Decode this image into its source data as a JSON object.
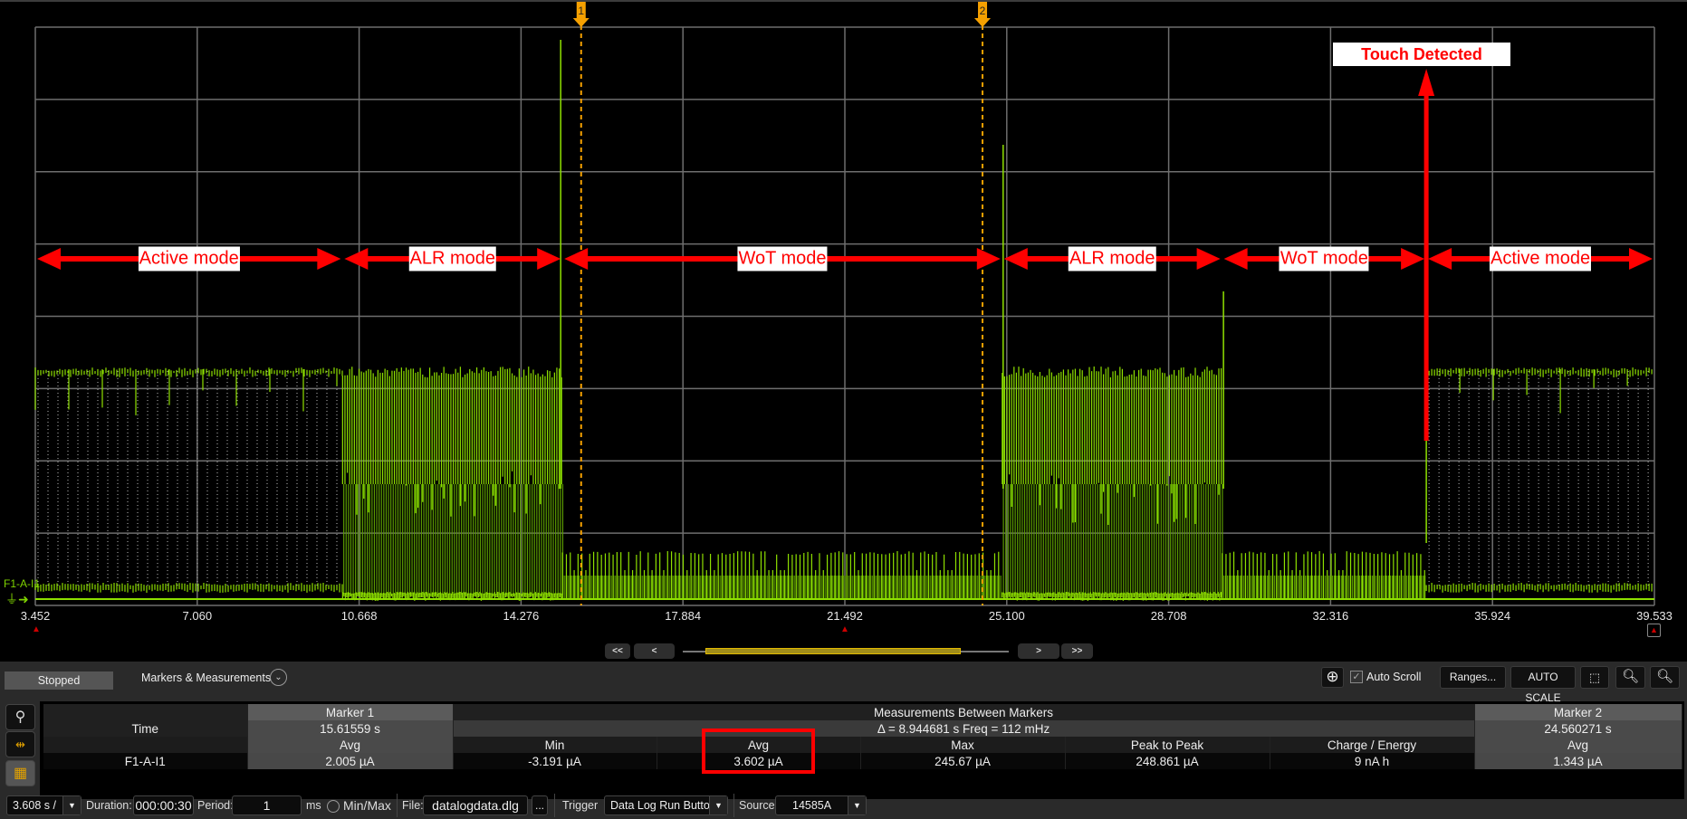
{
  "plot": {
    "channel_label": "F1-A-I1",
    "x_ticks": [
      "3.452",
      "7.060",
      "10.668",
      "14.276",
      "17.884",
      "21.492",
      "25.100",
      "28.708",
      "32.316",
      "35.924",
      "39.533"
    ],
    "x_range_s": [
      3.452,
      39.533
    ],
    "markers": [
      {
        "label": "1",
        "time_s": 15.61559
      },
      {
        "label": "2",
        "time_s": 24.560271
      }
    ],
    "trace_color": "#8ee000",
    "marker_color": "#f5a000",
    "annotation_color": "#ff0000",
    "annotations": {
      "modes": [
        {
          "label": "Active mode",
          "start_s": 3.452,
          "end_s": 10.3
        },
        {
          "label": "ALR mode",
          "start_s": 10.3,
          "end_s": 15.2
        },
        {
          "label": "WoT mode",
          "start_s": 15.2,
          "end_s": 25.0
        },
        {
          "label": "ALR mode",
          "start_s": 25.0,
          "end_s": 29.9
        },
        {
          "label": "WoT mode",
          "start_s": 29.9,
          "end_s": 34.45
        },
        {
          "label": "Active mode",
          "start_s": 34.45,
          "end_s": 39.533
        }
      ],
      "touch_label": "Touch Detected",
      "touch_time_s": 34.45
    }
  },
  "nav": {
    "first": "<<",
    "prev": "<",
    "next": ">",
    "last": ">>"
  },
  "status": {
    "state": "Stopped",
    "panel_title": "Markers & Measurements"
  },
  "toolbar_right": {
    "auto_scroll_label": "Auto Scroll",
    "auto_scroll_checked": true,
    "ranges": "Ranges...",
    "auto_scale": "AUTO SCALE"
  },
  "measurements": {
    "marker1_header": "Marker 1",
    "between_header": "Measurements Between Markers",
    "marker2_header": "Marker 2",
    "time_label": "Time",
    "marker1_time": "15.61559 s",
    "delta": "Δ = 8.944681 s   Freq = 112 mHz",
    "marker2_time": "24.560271 s",
    "columns": [
      "Avg",
      "Min",
      "Avg",
      "Max",
      "Peak to Peak",
      "Charge / Energy",
      "Avg"
    ],
    "channel": "F1-A-I1",
    "values": [
      "2.005 µA",
      "-3.191 µA",
      "3.602 µA",
      "245.67 µA",
      "248.861 µA",
      "9 nA h",
      "1.343 µA"
    ],
    "highlighted_column": "Avg (between markers)"
  },
  "bottom": {
    "timebase": "3.608 s /",
    "duration_label": "Duration:",
    "duration": "000:00:30",
    "period_label": "Period:",
    "period": "1",
    "period_unit": "ms",
    "minmax_label": "Min/Max",
    "minmax_checked": false,
    "file_label": "File:",
    "file": "datalogdata.dlg",
    "browse": "...",
    "trigger_label": "Trigger",
    "trigger": "Data Log Run Button",
    "source_label": "Source",
    "source": "14585A"
  }
}
